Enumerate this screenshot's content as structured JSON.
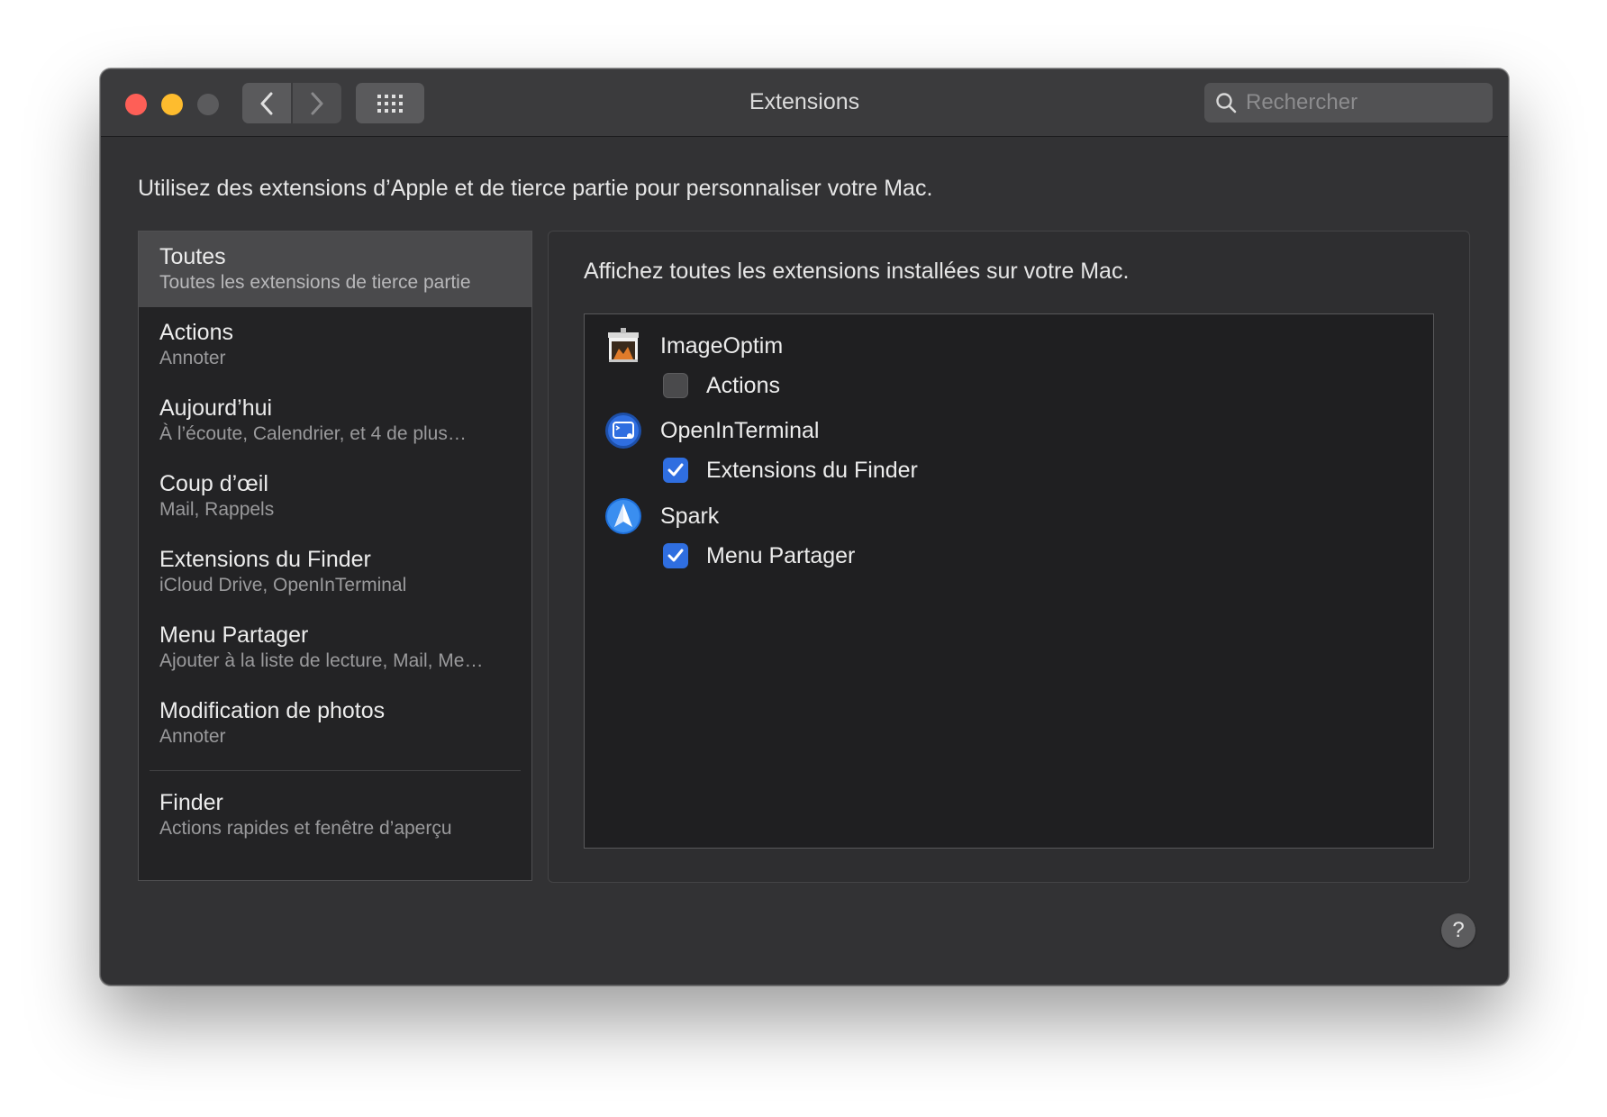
{
  "window": {
    "title": "Extensions"
  },
  "toolbar": {
    "back_icon": "chevron-left-icon",
    "forward_icon": "chevron-right-icon",
    "grid_icon": "grid-icon"
  },
  "search": {
    "placeholder": "Rechercher",
    "value": ""
  },
  "intro": "Utilisez des extensions d’Apple et de tierce partie pour personnaliser votre Mac.",
  "sidebar": {
    "items": [
      {
        "title": "Toutes",
        "subtitle": "Toutes les extensions de tierce partie",
        "selected": true
      },
      {
        "title": "Actions",
        "subtitle": "Annoter"
      },
      {
        "title": "Aujourd’hui",
        "subtitle": "À l’écoute, Calendrier, et 4 de plus…"
      },
      {
        "title": "Coup d’œil",
        "subtitle": "Mail, Rappels"
      },
      {
        "title": "Extensions du Finder",
        "subtitle": "iCloud Drive, OpenInTerminal"
      },
      {
        "title": "Menu Partager",
        "subtitle": "Ajouter à la liste de lecture, Mail, Me…"
      },
      {
        "title": "Modification de photos",
        "subtitle": "Annoter"
      },
      {
        "title": "Finder",
        "subtitle": "Actions rapides et fenêtre d’aperçu"
      }
    ]
  },
  "main": {
    "description": "Affichez toutes les extensions installées sur votre Mac.",
    "apps": [
      {
        "name": "ImageOptim",
        "icon": "imageoptim-icon",
        "extension": "Actions",
        "checked": false
      },
      {
        "name": "OpenInTerminal",
        "icon": "openinterminal-icon",
        "extension": "Extensions du Finder",
        "checked": true
      },
      {
        "name": "Spark",
        "icon": "spark-icon",
        "extension": "Menu Partager",
        "checked": true
      }
    ]
  },
  "help": {
    "label": "?"
  },
  "colors": {
    "accent": "#2f6ee0",
    "close": "#fe5f57",
    "minimize": "#febc2e"
  }
}
